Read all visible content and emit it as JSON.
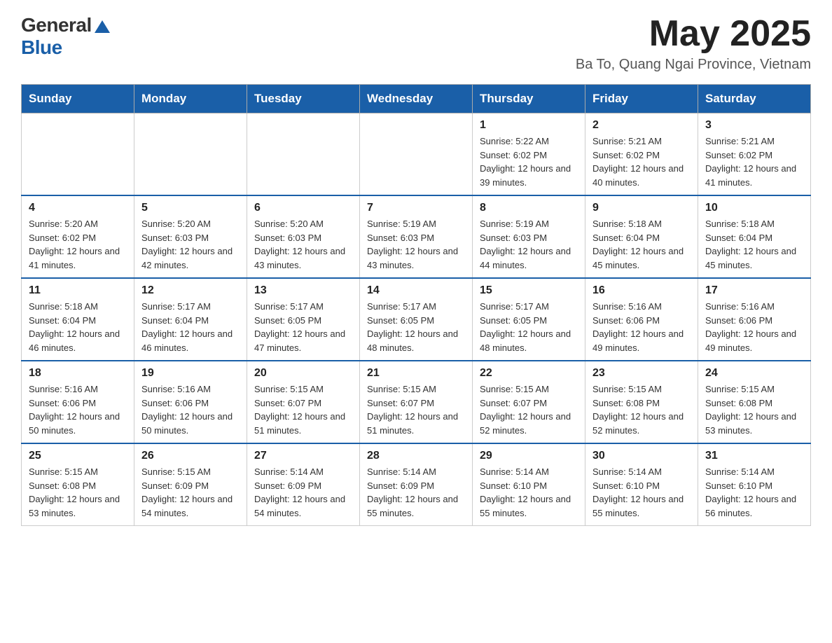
{
  "header": {
    "logo": {
      "general": "General",
      "blue": "Blue"
    },
    "month": "May 2025",
    "location": "Ba To, Quang Ngai Province, Vietnam"
  },
  "weekdays": [
    "Sunday",
    "Monday",
    "Tuesday",
    "Wednesday",
    "Thursday",
    "Friday",
    "Saturday"
  ],
  "weeks": [
    [
      {
        "day": "",
        "info": ""
      },
      {
        "day": "",
        "info": ""
      },
      {
        "day": "",
        "info": ""
      },
      {
        "day": "",
        "info": ""
      },
      {
        "day": "1",
        "info": "Sunrise: 5:22 AM\nSunset: 6:02 PM\nDaylight: 12 hours and 39 minutes."
      },
      {
        "day": "2",
        "info": "Sunrise: 5:21 AM\nSunset: 6:02 PM\nDaylight: 12 hours and 40 minutes."
      },
      {
        "day": "3",
        "info": "Sunrise: 5:21 AM\nSunset: 6:02 PM\nDaylight: 12 hours and 41 minutes."
      }
    ],
    [
      {
        "day": "4",
        "info": "Sunrise: 5:20 AM\nSunset: 6:02 PM\nDaylight: 12 hours and 41 minutes."
      },
      {
        "day": "5",
        "info": "Sunrise: 5:20 AM\nSunset: 6:03 PM\nDaylight: 12 hours and 42 minutes."
      },
      {
        "day": "6",
        "info": "Sunrise: 5:20 AM\nSunset: 6:03 PM\nDaylight: 12 hours and 43 minutes."
      },
      {
        "day": "7",
        "info": "Sunrise: 5:19 AM\nSunset: 6:03 PM\nDaylight: 12 hours and 43 minutes."
      },
      {
        "day": "8",
        "info": "Sunrise: 5:19 AM\nSunset: 6:03 PM\nDaylight: 12 hours and 44 minutes."
      },
      {
        "day": "9",
        "info": "Sunrise: 5:18 AM\nSunset: 6:04 PM\nDaylight: 12 hours and 45 minutes."
      },
      {
        "day": "10",
        "info": "Sunrise: 5:18 AM\nSunset: 6:04 PM\nDaylight: 12 hours and 45 minutes."
      }
    ],
    [
      {
        "day": "11",
        "info": "Sunrise: 5:18 AM\nSunset: 6:04 PM\nDaylight: 12 hours and 46 minutes."
      },
      {
        "day": "12",
        "info": "Sunrise: 5:17 AM\nSunset: 6:04 PM\nDaylight: 12 hours and 46 minutes."
      },
      {
        "day": "13",
        "info": "Sunrise: 5:17 AM\nSunset: 6:05 PM\nDaylight: 12 hours and 47 minutes."
      },
      {
        "day": "14",
        "info": "Sunrise: 5:17 AM\nSunset: 6:05 PM\nDaylight: 12 hours and 48 minutes."
      },
      {
        "day": "15",
        "info": "Sunrise: 5:17 AM\nSunset: 6:05 PM\nDaylight: 12 hours and 48 minutes."
      },
      {
        "day": "16",
        "info": "Sunrise: 5:16 AM\nSunset: 6:06 PM\nDaylight: 12 hours and 49 minutes."
      },
      {
        "day": "17",
        "info": "Sunrise: 5:16 AM\nSunset: 6:06 PM\nDaylight: 12 hours and 49 minutes."
      }
    ],
    [
      {
        "day": "18",
        "info": "Sunrise: 5:16 AM\nSunset: 6:06 PM\nDaylight: 12 hours and 50 minutes."
      },
      {
        "day": "19",
        "info": "Sunrise: 5:16 AM\nSunset: 6:06 PM\nDaylight: 12 hours and 50 minutes."
      },
      {
        "day": "20",
        "info": "Sunrise: 5:15 AM\nSunset: 6:07 PM\nDaylight: 12 hours and 51 minutes."
      },
      {
        "day": "21",
        "info": "Sunrise: 5:15 AM\nSunset: 6:07 PM\nDaylight: 12 hours and 51 minutes."
      },
      {
        "day": "22",
        "info": "Sunrise: 5:15 AM\nSunset: 6:07 PM\nDaylight: 12 hours and 52 minutes."
      },
      {
        "day": "23",
        "info": "Sunrise: 5:15 AM\nSunset: 6:08 PM\nDaylight: 12 hours and 52 minutes."
      },
      {
        "day": "24",
        "info": "Sunrise: 5:15 AM\nSunset: 6:08 PM\nDaylight: 12 hours and 53 minutes."
      }
    ],
    [
      {
        "day": "25",
        "info": "Sunrise: 5:15 AM\nSunset: 6:08 PM\nDaylight: 12 hours and 53 minutes."
      },
      {
        "day": "26",
        "info": "Sunrise: 5:15 AM\nSunset: 6:09 PM\nDaylight: 12 hours and 54 minutes."
      },
      {
        "day": "27",
        "info": "Sunrise: 5:14 AM\nSunset: 6:09 PM\nDaylight: 12 hours and 54 minutes."
      },
      {
        "day": "28",
        "info": "Sunrise: 5:14 AM\nSunset: 6:09 PM\nDaylight: 12 hours and 55 minutes."
      },
      {
        "day": "29",
        "info": "Sunrise: 5:14 AM\nSunset: 6:10 PM\nDaylight: 12 hours and 55 minutes."
      },
      {
        "day": "30",
        "info": "Sunrise: 5:14 AM\nSunset: 6:10 PM\nDaylight: 12 hours and 55 minutes."
      },
      {
        "day": "31",
        "info": "Sunrise: 5:14 AM\nSunset: 6:10 PM\nDaylight: 12 hours and 56 minutes."
      }
    ]
  ]
}
